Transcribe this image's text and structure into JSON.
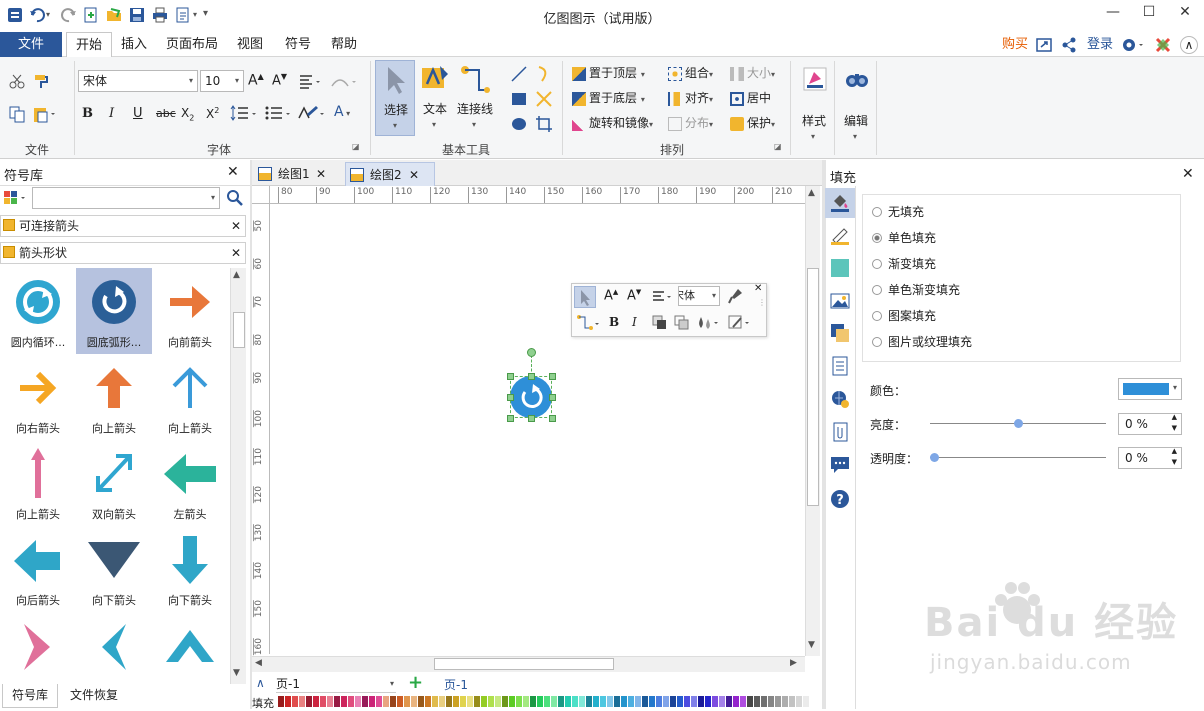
{
  "app": {
    "title": "亿图图示（试用版）"
  },
  "menu": {
    "file": "文件",
    "tabs": [
      "开始",
      "插入",
      "页面布局",
      "视图",
      "符号",
      "帮助"
    ],
    "right": {
      "buy": "购买",
      "login": "登录"
    }
  },
  "ribbon": {
    "groups": {
      "file": "文件",
      "font": "字体",
      "basic_tools": "基本工具",
      "arrange": "排列"
    },
    "font_name": "宋体",
    "font_size": "10",
    "tools": {
      "select": "选择",
      "text": "文本",
      "connector": "连接线"
    },
    "arrange": {
      "bring_front": "置于顶层",
      "send_back": "置于底层",
      "rotate_mirror": "旋转和镜像",
      "group": "组合",
      "align": "对齐",
      "distribute": "分布",
      "size": "大小",
      "center": "居中",
      "protect": "保护"
    },
    "style": "样式",
    "edit": "编辑"
  },
  "library": {
    "title": "符号库",
    "search_placeholder": "",
    "sections": [
      "可连接箭头",
      "箭头形状"
    ],
    "shapes": [
      {
        "label": "圆内循环..."
      },
      {
        "label": "圆底弧形..."
      },
      {
        "label": "向前箭头"
      },
      {
        "label": "向右箭头"
      },
      {
        "label": "向上箭头"
      },
      {
        "label": "向上箭头"
      },
      {
        "label": "向上箭头"
      },
      {
        "label": "双向箭头"
      },
      {
        "label": "左箭头"
      },
      {
        "label": "向后箭头"
      },
      {
        "label": "向下箭头"
      },
      {
        "label": "向下箭头"
      },
      {
        "label": ""
      },
      {
        "label": ""
      },
      {
        "label": ""
      }
    ],
    "bottom_tabs": [
      "符号库",
      "文件恢复"
    ]
  },
  "documents": {
    "tabs": [
      "绘图1",
      "绘图2"
    ]
  },
  "ruler": {
    "h": [
      "80",
      "90",
      "100",
      "110",
      "120",
      "130",
      "140",
      "150",
      "160",
      "170",
      "180",
      "190",
      "200",
      "210"
    ],
    "v": [
      "50",
      "60",
      "70",
      "80",
      "90",
      "100",
      "110",
      "120",
      "130",
      "140",
      "150",
      "160"
    ]
  },
  "mini_toolbar": {
    "font": "宋体"
  },
  "pages": {
    "current": "页-1",
    "tab": "页-1"
  },
  "palette": {
    "label": "填充"
  },
  "fill_panel": {
    "title": "填充",
    "options": [
      "无填充",
      "单色填充",
      "渐变填充",
      "单色渐变填充",
      "图案填充",
      "图片或纹理填充"
    ],
    "selected": "单色填充",
    "color_label": "颜色：",
    "color_value": "#2e8fd8",
    "brightness_label": "亮度：",
    "brightness_value": "0 %",
    "transparency_label": "透明度：",
    "transparency_value": "0 %",
    "brightness_fraction": 0.5,
    "transparency_fraction": 0.0
  },
  "watermark": {
    "brand": "Bai du 经验",
    "url": "jingyan.baidu.com"
  }
}
